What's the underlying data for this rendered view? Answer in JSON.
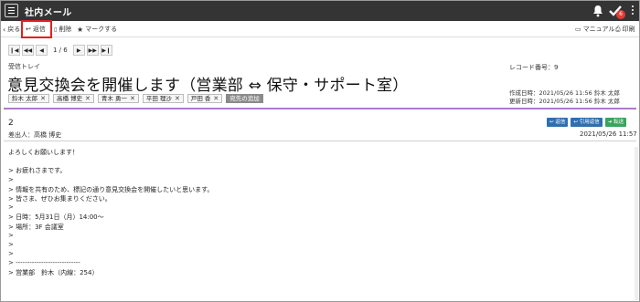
{
  "app": {
    "title": "社内メール",
    "notification_count": "6"
  },
  "toolbar": {
    "back": "戻る",
    "reply": "返信",
    "delete": "削除",
    "mark": "マークする",
    "manual": "マニュアル",
    "print": "印刷"
  },
  "pager": {
    "current": "1 / 6"
  },
  "mail": {
    "folder": "受信トレイ",
    "subject": "意見交換会を開催します（営業部 ⇔ 保守・サポート室）",
    "record_no": "レコード番号：9",
    "created": "作成日時：2021/05/26 11:56 鈴木 太郎",
    "updated": "更新日時：2021/05/26 11:56 鈴木 太郎",
    "recipients": [
      "鈴木 太郎",
      "高橋 博史",
      "青木 勇一",
      "平田 理沙",
      "戸田 香"
    ],
    "add_recipient": "宛先の追加"
  },
  "message": {
    "number": "2",
    "sender": "差出人：高橋 博史",
    "date": "2021/05/26 11:57",
    "buttons": {
      "reply": "返信",
      "quote_reply": "引用返信",
      "forward": "転送"
    },
    "body": [
      "よろしくお願いします！",
      "",
      "> お疲れさまです。",
      ">",
      "> 情報を共有のため、標記の通り意見交換会を開催したいと思います。",
      "> 皆さま、ぜひお集まりください。",
      ">",
      "> 日時：5月31日（月）14:00～",
      "> 場所：3F 会議室",
      ">",
      ">",
      ">",
      "> ----------------------------",
      "> 営業部　鈴木（内線：254）"
    ]
  }
}
